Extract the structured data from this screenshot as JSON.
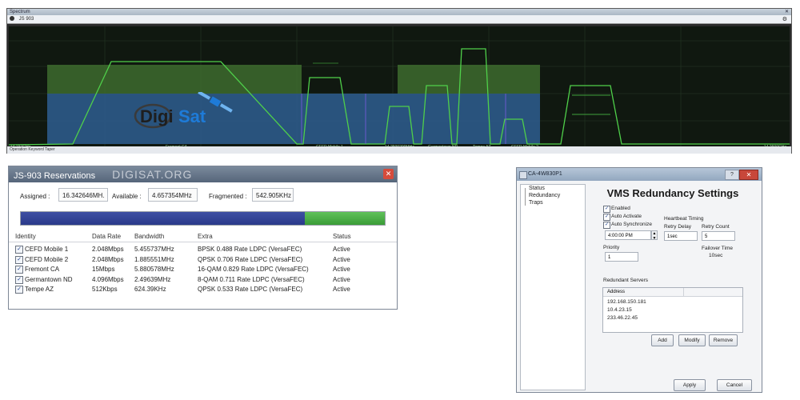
{
  "spectrum": {
    "window_title": "Spectrum",
    "menu_label": "JS 903",
    "left_freq": "14.237GHz",
    "center_freq": "14.2600200MHz",
    "right_freq": "14.2600GHz",
    "status_text": "Operation Keyword Taper",
    "carrier_labels": [
      "Fremont CA",
      "CEFD Mobile 1",
      "Germantown ND",
      "Tempe AZ",
      "CEFD Mobile 2"
    ],
    "logo_text": "DigiSat",
    "colors": {
      "trace": "#4fd04a",
      "band_green": "#3d6b2e",
      "band_blue": "#2c5a8a",
      "background": "#101810"
    }
  },
  "reservations": {
    "title": "JS-903 Reservations",
    "brand": "DIGISAT.ORG",
    "close_icon": "close-icon",
    "assigned_label": "Assigned :",
    "assigned_value": "16.342646MH.",
    "available_label": "Available :",
    "available_value": "4.657354MHz",
    "fragmented_label": "Fragmented :",
    "fragmented_value": "542.905KHz",
    "usage_fraction": 0.78,
    "columns": [
      "Identity",
      "Data Rate",
      "Bandwidth",
      "Extra",
      "Status"
    ],
    "rows": [
      {
        "checked": true,
        "identity": "CEFD Mobile 1",
        "rate": "2.048Mbps",
        "bandwidth": "5.455737MHz",
        "extra": "BPSK 0.488 Rate  LDPC (VersaFEC)",
        "status": "Active"
      },
      {
        "checked": true,
        "identity": "CEFD Mobile 2",
        "rate": "2.048Mbps",
        "bandwidth": "1.885551MHz",
        "extra": "QPSK 0.706 Rate  LDPC (VersaFEC)",
        "status": "Active"
      },
      {
        "checked": true,
        "identity": "Fremont CA",
        "rate": "15Mbps",
        "bandwidth": "5.880578MHz",
        "extra": "16-QAM 0.829 Rate  LDPC (VersaFEC)",
        "status": "Active"
      },
      {
        "checked": true,
        "identity": "Germantown ND",
        "rate": "4.096Mbps",
        "bandwidth": "2.49639MHz",
        "extra": "8-QAM 0.711 Rate  LDPC (VersaFEC)",
        "status": "Active"
      },
      {
        "checked": true,
        "identity": "Tempe AZ",
        "rate": "512Kbps",
        "bandwidth": "624.39KHz",
        "extra": "QPSK 0.533 Rate  LDPC (VersaFEC)",
        "status": "Active"
      }
    ]
  },
  "vms": {
    "window_title": "CA-4W830P1",
    "help_label": "?",
    "tree": [
      "Status",
      "Redundancy",
      "Traps"
    ],
    "heading": "VMS Redundancy Settings",
    "enabled_label": "Enabled",
    "auto_activate_label": "Auto Activate",
    "auto_sync_label": "Auto Synchronize",
    "sync_time": "4:00:00 PM",
    "heartbeat_label": "Heartbeat Timing",
    "retry_delay_label": "Retry Delay",
    "retry_delay_value": "1sec",
    "retry_count_label": "Retry Count",
    "retry_count_value": "5",
    "priority_label": "Priority",
    "priority_value": "1",
    "failover_label": "Failover Time",
    "failover_value": "10sec",
    "servers_label": "Redundant Servers",
    "servers_column": "Address",
    "servers": [
      "192.168.150.181",
      "10.4.23.15",
      "233.46.22.45"
    ],
    "add_label": "Add",
    "modify_label": "Modify",
    "remove_label": "Remove",
    "apply_label": "Apply",
    "cancel_label": "Cancel"
  }
}
